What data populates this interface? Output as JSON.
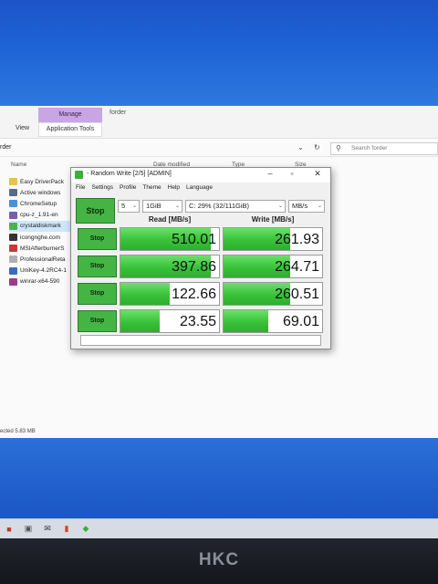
{
  "explorer": {
    "ribbon": {
      "manage_tab": "Manage",
      "folder_tab": "forder",
      "view_tab": "View",
      "app_tools_tab": "Application Tools"
    },
    "address": {
      "path": "rder",
      "search_placeholder": "Search forder"
    },
    "columns": {
      "name": "Name",
      "date_modified": "Date modified",
      "type": "Type",
      "size": "Size"
    },
    "files": [
      {
        "name": "Easy DriverPack",
        "icon": "folder-icon",
        "color": "#e8c152"
      },
      {
        "name": "Active windows",
        "icon": "app-icon",
        "color": "#5a6b8a"
      },
      {
        "name": "ChromeSetup",
        "icon": "chrome-icon",
        "color": "#4a8fd8"
      },
      {
        "name": "cpu-z_1.91-en",
        "icon": "chip-icon",
        "color": "#7a5cb0"
      },
      {
        "name": "crystaldiskmark",
        "icon": "disk-icon",
        "color": "#4caf50",
        "selected": true
      },
      {
        "name": "icongnghe.com",
        "icon": "app-icon",
        "color": "#333"
      },
      {
        "name": "MSIAfterburnerS",
        "icon": "app-icon",
        "color": "#c43a3a"
      },
      {
        "name": "ProfessionalReta",
        "icon": "doc-icon",
        "color": "#b0b0b0"
      },
      {
        "name": "UniKey-4.2RC4-1",
        "icon": "app-icon",
        "color": "#3a6ac4"
      },
      {
        "name": "winrar-x64-590",
        "icon": "archive-icon",
        "color": "#a03a8a"
      }
    ],
    "status": "ected  5.83 MB"
  },
  "cdm": {
    "title": "- Random Write [2/5] [ADMIN]",
    "menu": [
      "File",
      "Settings",
      "Profile",
      "Theme",
      "Help",
      "Language"
    ],
    "stop_all": "Stop",
    "count": "5",
    "size": "1GiB",
    "drive": "C: 29% (32/111GiB)",
    "unit": "MB/s",
    "read_label": "Read [MB/s]",
    "write_label": "Write [MB/s]",
    "rows": [
      {
        "button": "Stop",
        "read": "510.01",
        "write": "261.93",
        "read_fill": 0.92,
        "write_fill": 0.68
      },
      {
        "button": "Stop",
        "read": "397.86",
        "write": "264.71",
        "read_fill": 0.92,
        "write_fill": 0.68
      },
      {
        "button": "Stop",
        "read": "122.66",
        "write": "260.51",
        "read_fill": 0.5,
        "write_fill": 0.68
      },
      {
        "button": "Stop",
        "read": "23.55",
        "write": "69.01",
        "read_fill": 0.4,
        "write_fill": 0.45
      }
    ],
    "colors": {
      "accent": "#44b544",
      "fill": "#38c238"
    }
  },
  "monitor": {
    "brand": "HKC"
  }
}
